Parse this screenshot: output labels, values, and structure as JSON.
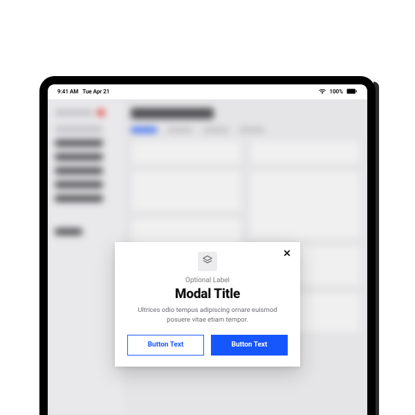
{
  "status_bar": {
    "time": "9:41 AM",
    "date": "Tue Apr 21",
    "battery_text": "100%"
  },
  "modal": {
    "label": "Optional Label",
    "title": "Modal Title",
    "body": "Ultrices odio tempus adipiscing ornare euismod posuere vitae etiam tempor.",
    "secondary_button": "Button Text",
    "primary_button": "Button Text"
  }
}
